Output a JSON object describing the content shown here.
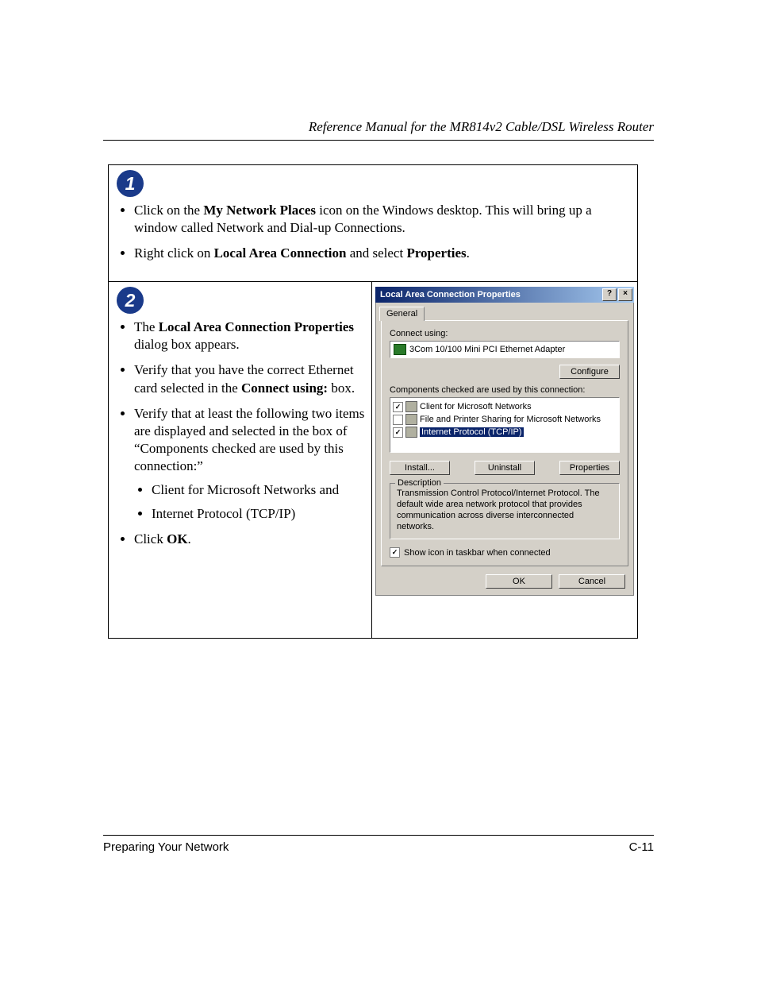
{
  "doc": {
    "running_head": "Reference Manual for the MR814v2 Cable/DSL Wireless Router",
    "footer_left": "Preparing Your Network",
    "footer_right": "C-11"
  },
  "step1": {
    "badge": "1",
    "b1_pre": "Click on the ",
    "b1_bold": "My Network Places",
    "b1_post": " icon on the Windows desktop.  This will bring up a window called Network and Dial-up Connections.",
    "b2_pre": "Right click on ",
    "b2_bold1": "Local Area Connection",
    "b2_mid": " and select ",
    "b2_bold2": "Properties",
    "b2_post": "."
  },
  "step2": {
    "badge": "2",
    "b1_pre": "The ",
    "b1_bold": "Local Area Connection Properties",
    "b1_post": " dialog box appears.",
    "b2_pre": "Verify that you have the correct Ethernet card selected in the ",
    "b2_bold": "Connect using:",
    "b2_post": " box.",
    "b3": "Verify that at least the following two items are displayed and selected in the box of “Components checked are used by this connection:”",
    "sub1": "Client for Microsoft Networks and",
    "sub2": "Internet Protocol (TCP/IP)",
    "b4_pre": "Click ",
    "b4_bold": "OK",
    "b4_post": "."
  },
  "dialog": {
    "title": "Local Area Connection Properties",
    "help_glyph": "?",
    "close_glyph": "×",
    "tab_general": "General",
    "connect_using_label": "Connect using:",
    "adapter": "3Com 10/100 Mini PCI Ethernet Adapter",
    "configure_btn": "Configure",
    "components_label": "Components checked are used by this connection:",
    "comp_client": "Client for Microsoft Networks",
    "comp_fileshare": "File and Printer Sharing for Microsoft Networks",
    "comp_tcpip": "Internet Protocol (TCP/IP)",
    "install_btn": "Install...",
    "uninstall_btn": "Uninstall",
    "properties_btn": "Properties",
    "desc_legend": "Description",
    "desc_text": "Transmission Control Protocol/Internet Protocol. The default wide area network protocol that provides communication across diverse interconnected networks.",
    "show_taskbar": "Show icon in taskbar when connected",
    "ok_btn": "OK",
    "cancel_btn": "Cancel"
  }
}
